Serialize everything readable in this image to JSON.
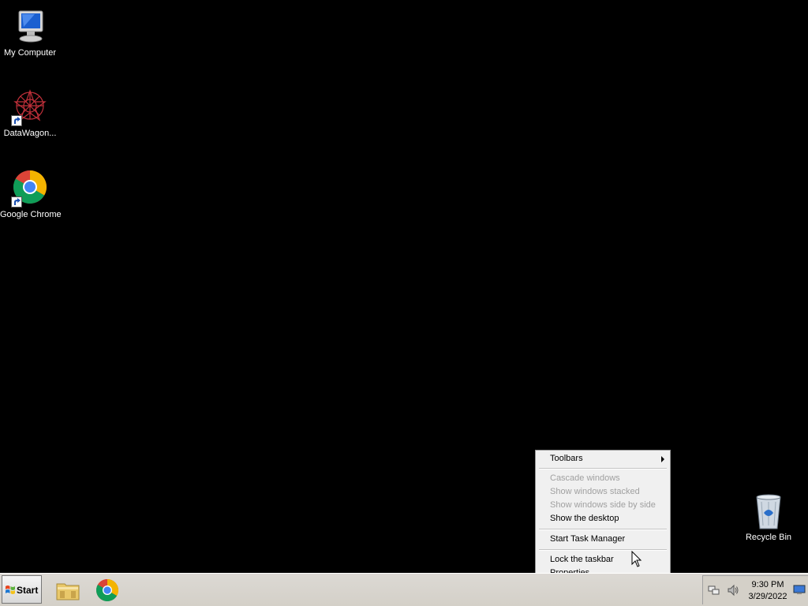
{
  "desktop": {
    "icons": [
      {
        "label": "My Computer",
        "icon": "computer-icon"
      },
      {
        "label": "DataWagon...",
        "icon": "datawagon-icon"
      },
      {
        "label": "Google Chrome",
        "icon": "chrome-icon"
      },
      {
        "label": "Recycle Bin",
        "icon": "recycle-bin-icon"
      }
    ]
  },
  "context_menu": {
    "items": [
      {
        "label": "Toolbars",
        "enabled": true,
        "submenu": true
      },
      {
        "label": "Cascade windows",
        "enabled": false
      },
      {
        "label": "Show windows stacked",
        "enabled": false
      },
      {
        "label": "Show windows side by side",
        "enabled": false
      },
      {
        "label": "Show the desktop",
        "enabled": true
      },
      {
        "label": "Start Task Manager",
        "enabled": true
      },
      {
        "label": "Lock the taskbar",
        "enabled": true
      },
      {
        "label": "Properties",
        "enabled": true
      }
    ]
  },
  "taskbar": {
    "start_label": "Start",
    "quick_launch": [
      {
        "icon": "explorer-folder-icon"
      },
      {
        "icon": "chrome-icon"
      }
    ],
    "tray": {
      "time": "9:30 PM",
      "date": "3/29/2022",
      "icons": [
        "network-icon",
        "volume-icon",
        "show-desktop-icon"
      ]
    }
  },
  "colors": {
    "desktop_bg": "#000000",
    "taskbar_bg": "#d4d0c8",
    "menu_bg": "#f0f0f0",
    "disabled_text": "#a0a0a0"
  }
}
